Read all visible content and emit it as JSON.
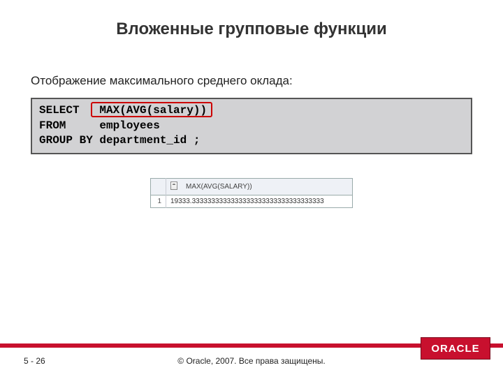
{
  "title": "Вложенные групповые функции",
  "subtitle": "Отображение максимального среднего оклада:",
  "code": {
    "line1": "SELECT   MAX(AVG(salary))",
    "line2": "FROM     employees",
    "line3": "GROUP BY department_id ;"
  },
  "result": {
    "column_header": "MAX(AVG(SALARY))",
    "row_number": "1",
    "value": "19333.3333333333333333333333333333333333"
  },
  "footer": {
    "page": "5 - 26",
    "copyright": "© Oracle, 2007. Все права защищены.",
    "logo": "ORACLE"
  }
}
